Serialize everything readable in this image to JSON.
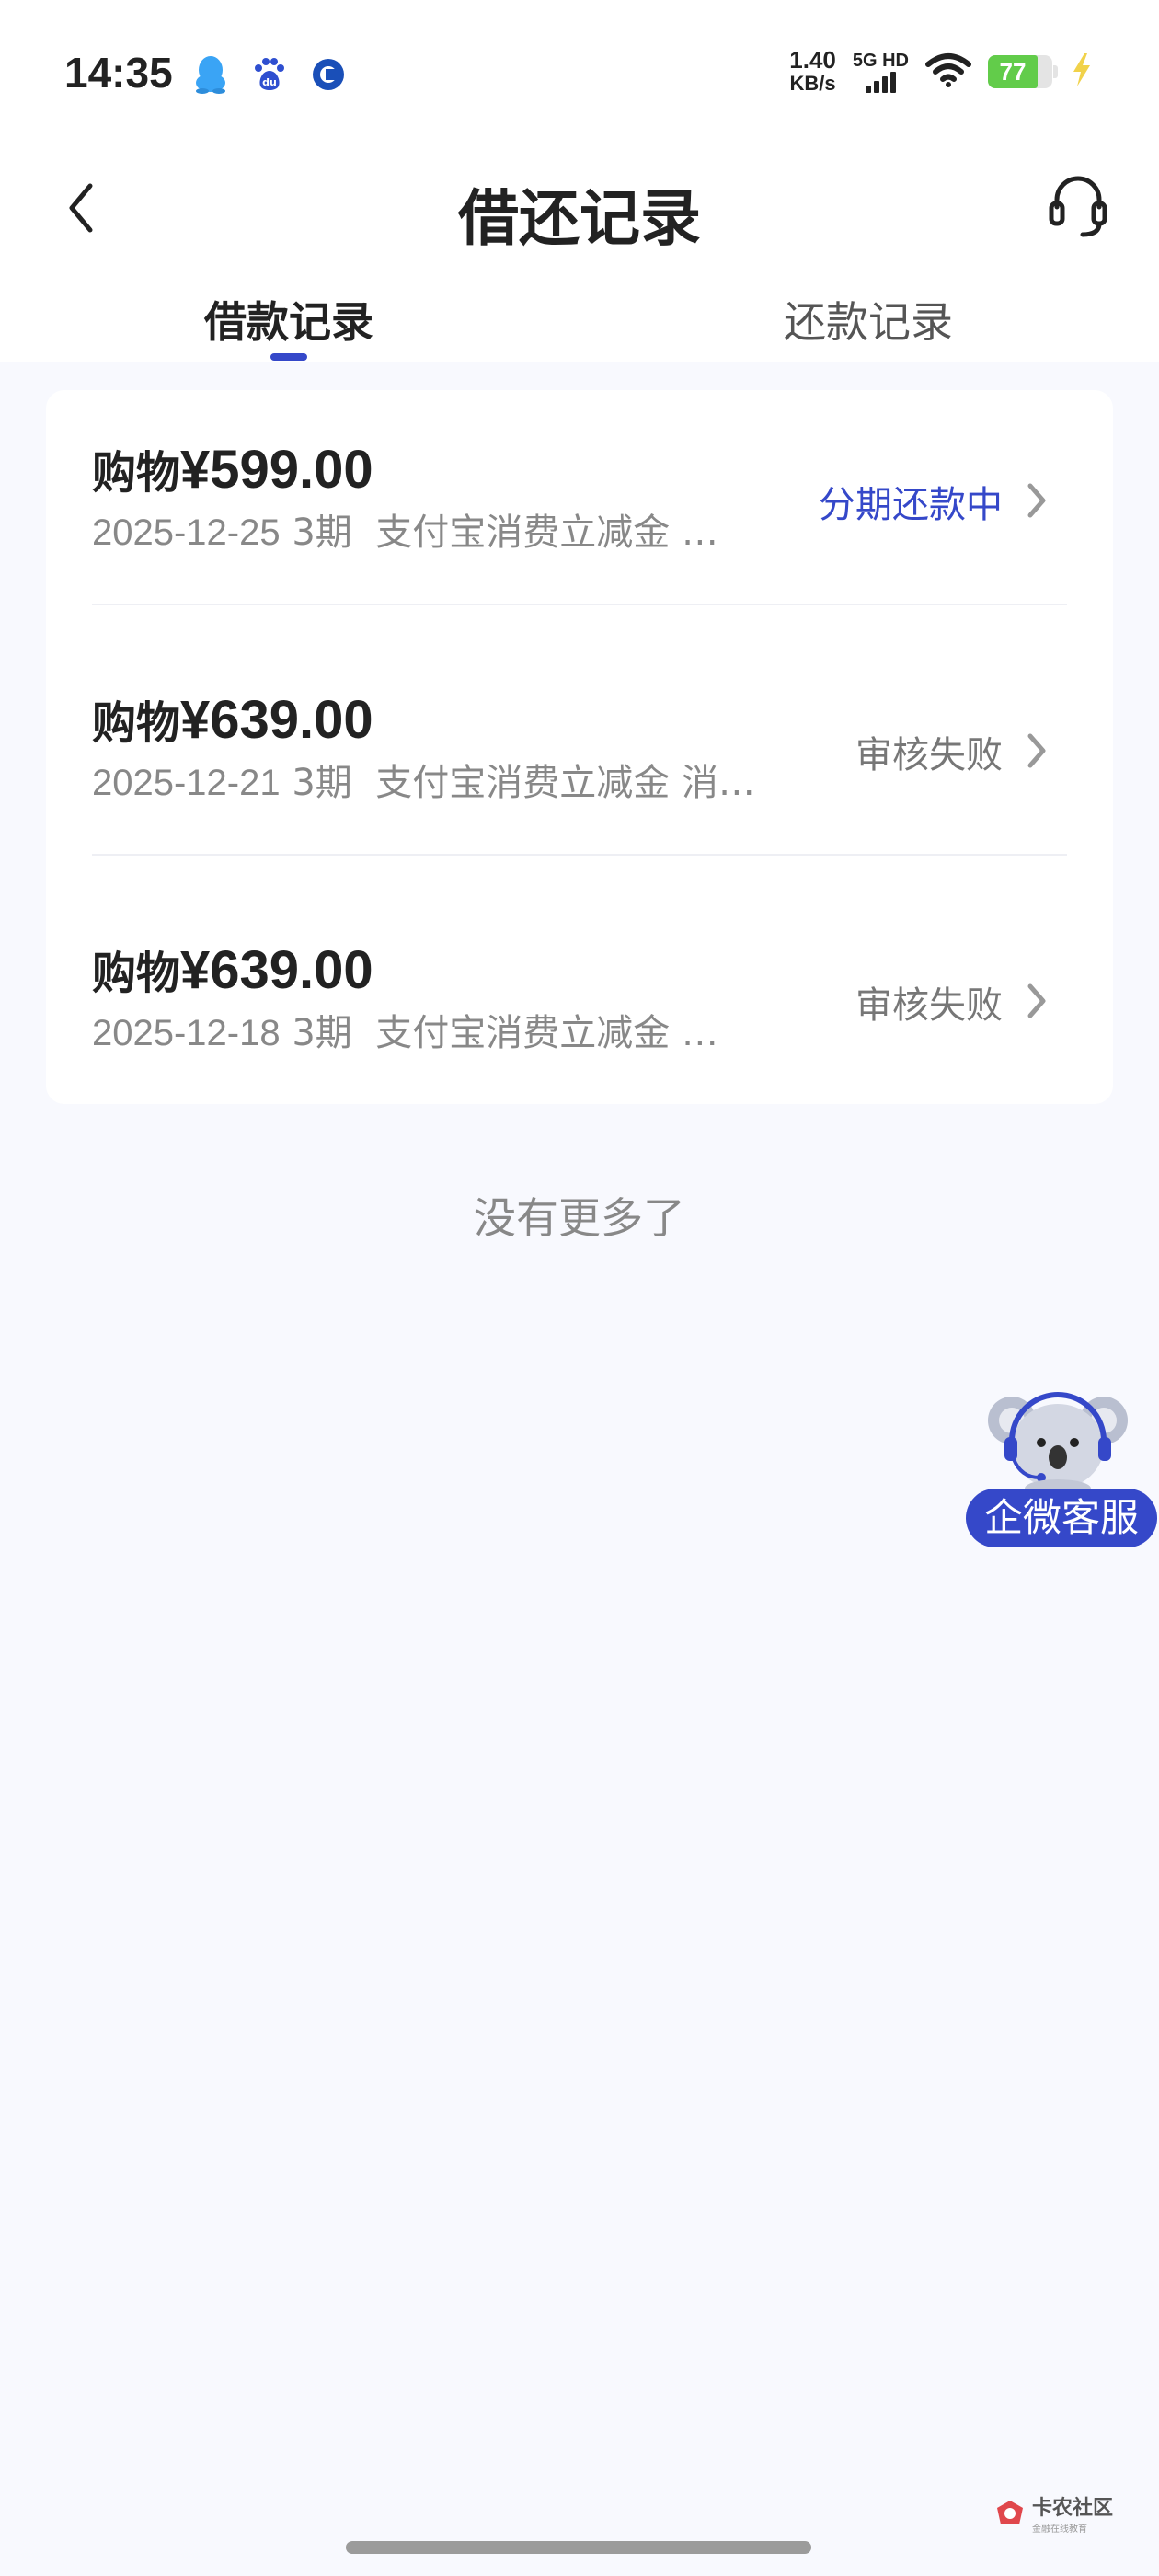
{
  "status_bar": {
    "time": "14:35",
    "app_icons": [
      "qq-icon",
      "baidu-icon",
      "bank-app-icon"
    ],
    "net_speed_value": "1.40",
    "net_speed_unit": "KB/s",
    "network_type": "5G HD",
    "battery_level": "77"
  },
  "header": {
    "title": "借还记录"
  },
  "tabs": [
    {
      "label": "借款记录",
      "active": true
    },
    {
      "label": "还款记录",
      "active": false
    }
  ],
  "records": [
    {
      "prefix": "购物",
      "amount": "¥599.00",
      "date": "2025-12-25",
      "periods": "3期",
      "desc": "支付宝消费立减金 …",
      "status": "分期还款中",
      "status_color": "#3548c9"
    },
    {
      "prefix": "购物",
      "amount": "¥639.00",
      "date": "2025-12-21",
      "periods": "3期",
      "desc": "支付宝消费立减金 消…",
      "status": "审核失败",
      "status_color": "#777777"
    },
    {
      "prefix": "购物",
      "amount": "¥639.00",
      "date": "2025-12-18",
      "periods": "3期",
      "desc": "支付宝消费立减金 …",
      "status": "审核失败",
      "status_color": "#777777"
    }
  ],
  "footer_text": "没有更多了",
  "floating_service": {
    "label": "企微客服"
  },
  "watermark": {
    "title": "卡农社区",
    "subtitle": "金融在线教育"
  },
  "colors": {
    "accent": "#3548c9",
    "background": "#f8f9fe",
    "card": "#ffffff"
  }
}
